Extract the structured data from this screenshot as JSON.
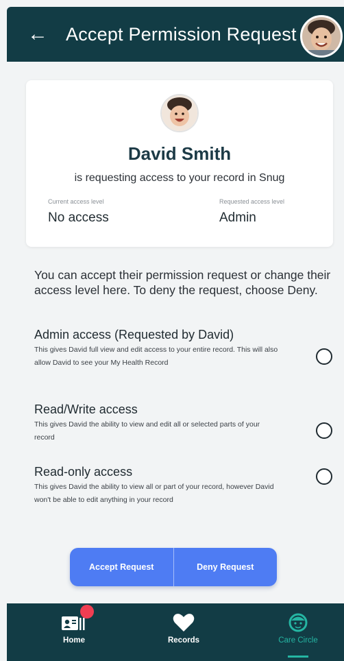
{
  "header": {
    "title": "Accept Permission Request",
    "back_icon": "arrow-left-icon",
    "avatar_icon": "user-avatar"
  },
  "card": {
    "name": "David Smith",
    "request_text": "is requesting access to your record in Snug",
    "current_label": "Current access level",
    "current_value": "No access",
    "requested_label": "Requested access level",
    "requested_value": "Admin"
  },
  "intro": "You can accept their permission request or change their access level here. To deny the request, choose Deny.",
  "options": [
    {
      "title": "Admin access (Requested by David)",
      "desc": "This gives David full view and edit access to your entire record. This will also allow David to see your My Health Record",
      "selected": false
    },
    {
      "title": "Read/Write access",
      "desc": "This gives David the ability to view and edit all or selected parts of your record",
      "selected": false
    },
    {
      "title": "Read-only access",
      "desc": "This gives David the ability to view all or part of your record, however David won't be able to edit anything in your record",
      "selected": false
    }
  ],
  "buttons": {
    "accept": "Accept Request",
    "deny": "Deny Request"
  },
  "nav": {
    "items": [
      {
        "label": "Home",
        "icon": "contact-card-icon",
        "active": false
      },
      {
        "label": "Records",
        "icon": "heart-icon",
        "active": false
      },
      {
        "label": "Care Circle",
        "icon": "baby-face-icon",
        "active": true
      }
    ]
  },
  "colors": {
    "header_bg": "#123c45",
    "accent": "#4e7cf3",
    "active_nav": "#25b6a3",
    "badge": "#f03e52"
  }
}
